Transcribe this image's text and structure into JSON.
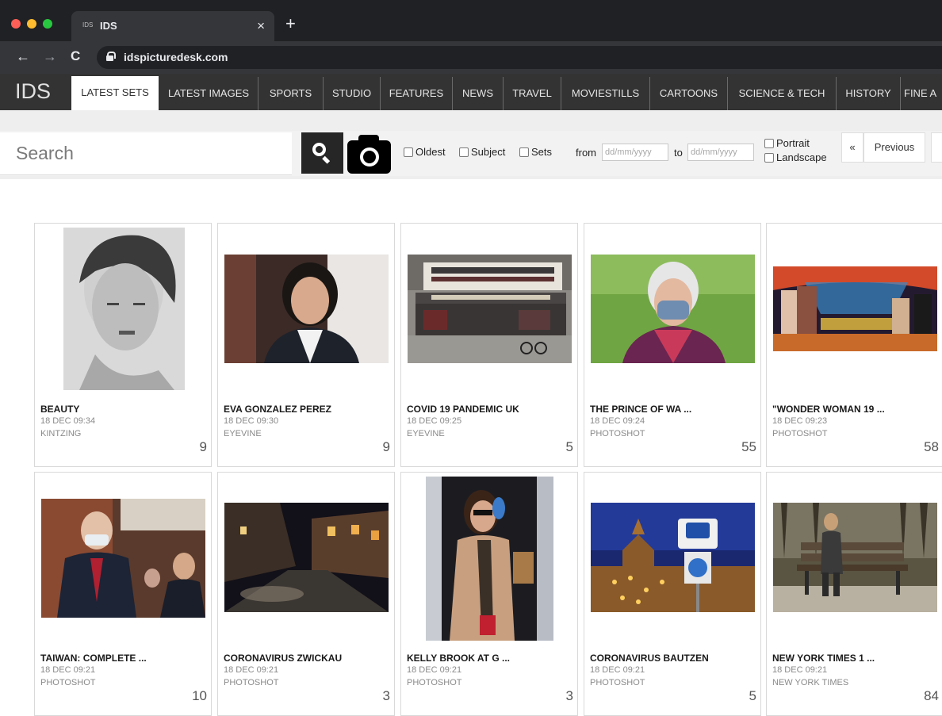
{
  "browser": {
    "tab_favicon": "IDS",
    "tab_title": "IDS",
    "tab_close": "×",
    "new_tab": "+",
    "back": "←",
    "forward": "→",
    "reload": "C",
    "url": "idspicturedesk.com"
  },
  "site": {
    "logo": "IDS",
    "menu": [
      "LATEST SETS",
      "LATEST IMAGES",
      "SPORTS",
      "STUDIO",
      "FEATURES",
      "NEWS",
      "TRAVEL",
      "MOVIESTILLS",
      "CARTOONS",
      "SCIENCE & TECH",
      "HISTORY",
      "FINE A"
    ],
    "active_menu": "LATEST SETS"
  },
  "toolbar": {
    "search_placeholder": "Search",
    "oldest": "Oldest",
    "subject": "Subject",
    "sets": "Sets",
    "from": "from",
    "to": "to",
    "date_placeholder": "dd/mm/yyyy",
    "portrait": "Portrait",
    "landscape": "Landscape",
    "first": "«",
    "previous": "Previous"
  },
  "sets": [
    {
      "title": "BEAUTY",
      "date": "18 DEC 09:34",
      "agency": "KINTZING",
      "count": "9"
    },
    {
      "title": "EVA GONZALEZ PEREZ",
      "date": "18 DEC 09:30",
      "agency": "EYEVINE",
      "count": "9"
    },
    {
      "title": "COVID 19 PANDEMIC UK",
      "date": "18 DEC 09:25",
      "agency": "EYEVINE",
      "count": "5"
    },
    {
      "title": "THE PRINCE OF WA ...",
      "date": "18 DEC 09:24",
      "agency": "PHOTOSHOT",
      "count": "55"
    },
    {
      "title": "\"WONDER WOMAN 19 ...",
      "date": "18 DEC 09:23",
      "agency": "PHOTOSHOT",
      "count": "58"
    },
    {
      "title": "TAIWAN: COMPLETE ...",
      "date": "18 DEC 09:21",
      "agency": "PHOTOSHOT",
      "count": "10"
    },
    {
      "title": "CORONAVIRUS ZWICKAU",
      "date": "18 DEC 09:21",
      "agency": "PHOTOSHOT",
      "count": "3"
    },
    {
      "title": "KELLY BROOK AT G ...",
      "date": "18 DEC 09:21",
      "agency": "PHOTOSHOT",
      "count": "3"
    },
    {
      "title": "CORONAVIRUS BAUTZEN",
      "date": "18 DEC 09:21",
      "agency": "PHOTOSHOT",
      "count": "5"
    },
    {
      "title": "NEW YORK TIMES 1 ...",
      "date": "18 DEC 09:21",
      "agency": "NEW YORK TIMES",
      "count": "84"
    }
  ]
}
